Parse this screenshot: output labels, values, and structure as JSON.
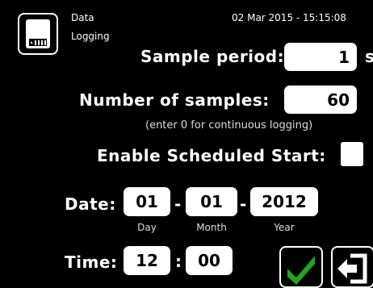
{
  "header": {
    "title_line1": "Data",
    "title_line2": "Logging",
    "datetime": "02 Mar 2015 - 15:15:08"
  },
  "sample_period": {
    "label": "Sample period:",
    "value": "1",
    "unit": "s"
  },
  "number_of_samples": {
    "label": "Number of samples:",
    "value": "60"
  },
  "hint": "(enter 0 for continuous logging)",
  "scheduled_start": {
    "label": "Enable Scheduled Start:",
    "checked": false
  },
  "date": {
    "label": "Date:",
    "day": "01",
    "month": "01",
    "year": "2012",
    "separator": "-",
    "day_caption": "Day",
    "month_caption": "Month",
    "year_caption": "Year"
  },
  "time": {
    "label": "Time:",
    "hour": "12",
    "minute": "00",
    "separator": ":"
  },
  "icons": {
    "logging": "data-logging-icon",
    "confirm": "checkmark-icon",
    "exit": "exit-icon"
  },
  "colors": {
    "confirm_green": "#1fa51f",
    "background": "#000000",
    "field": "#ffffff"
  }
}
